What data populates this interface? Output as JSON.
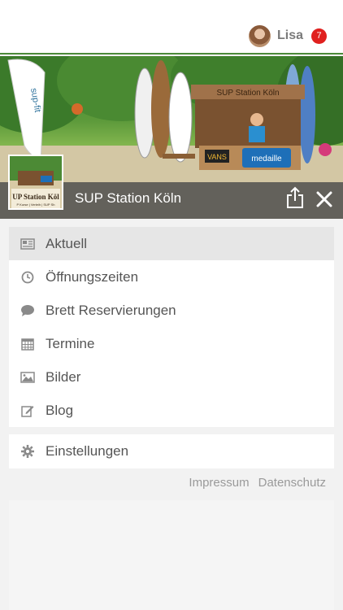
{
  "header": {
    "user_name": "Lisa",
    "notification_count": "7"
  },
  "station": {
    "title": "SUP Station Köln",
    "banner_sign": "SUP Station Köln",
    "thumb_sign": "UP Station Köl",
    "thumb_subtext": "P Kurse | Verleih | SUP Sh"
  },
  "menu": {
    "items": [
      {
        "label": "Aktuell",
        "icon": "newspaper-icon",
        "active": true
      },
      {
        "label": "Öffnungszeiten",
        "icon": "clock-icon",
        "active": false
      },
      {
        "label": "Brett Reservierungen",
        "icon": "chat-bubble-icon",
        "active": false
      },
      {
        "label": "Termine",
        "icon": "calendar-icon",
        "active": false
      },
      {
        "label": "Bilder",
        "icon": "image-icon",
        "active": false
      },
      {
        "label": "Blog",
        "icon": "edit-icon",
        "active": false
      }
    ],
    "settings_label": "Einstellungen",
    "settings_icon": "gear-icon"
  },
  "footer": {
    "impressum": "Impressum",
    "datenschutz": "Datenschutz"
  },
  "colors": {
    "badge": "#e0201e",
    "accent_line": "#4d8b3a",
    "active_item": "#e6e6e6"
  }
}
